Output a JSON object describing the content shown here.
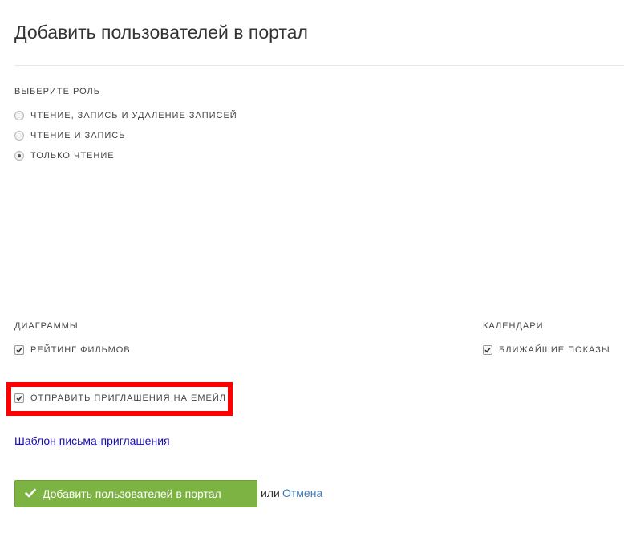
{
  "header": {
    "title": "Добавить пользователей в портал"
  },
  "role_section": {
    "label": "Выберите роль",
    "options": [
      {
        "label": "Чтение, запись и удаление записей",
        "checked": false
      },
      {
        "label": "Чтение и запись",
        "checked": false
      },
      {
        "label": "Только чтение",
        "checked": true
      }
    ]
  },
  "diagrams_section": {
    "label": "Диаграммы",
    "items": [
      {
        "label": "Рейтинг фильмов",
        "checked": true
      }
    ]
  },
  "calendars_section": {
    "label": "Календари",
    "items": [
      {
        "label": "Ближайшие показы",
        "checked": true
      }
    ]
  },
  "email_invite": {
    "label": "Отправить приглашения на емейл",
    "checked": true
  },
  "template_link": "Шаблон письма-приглашения",
  "actions": {
    "submit_label": "Добавить пользователей в портал",
    "or_text": "или",
    "cancel_label": "Отмена"
  },
  "colors": {
    "submit_bg": "#7cb342",
    "highlight": "#ff0000",
    "link": "#1a0dab",
    "cancel_link": "#3d7ab8"
  }
}
